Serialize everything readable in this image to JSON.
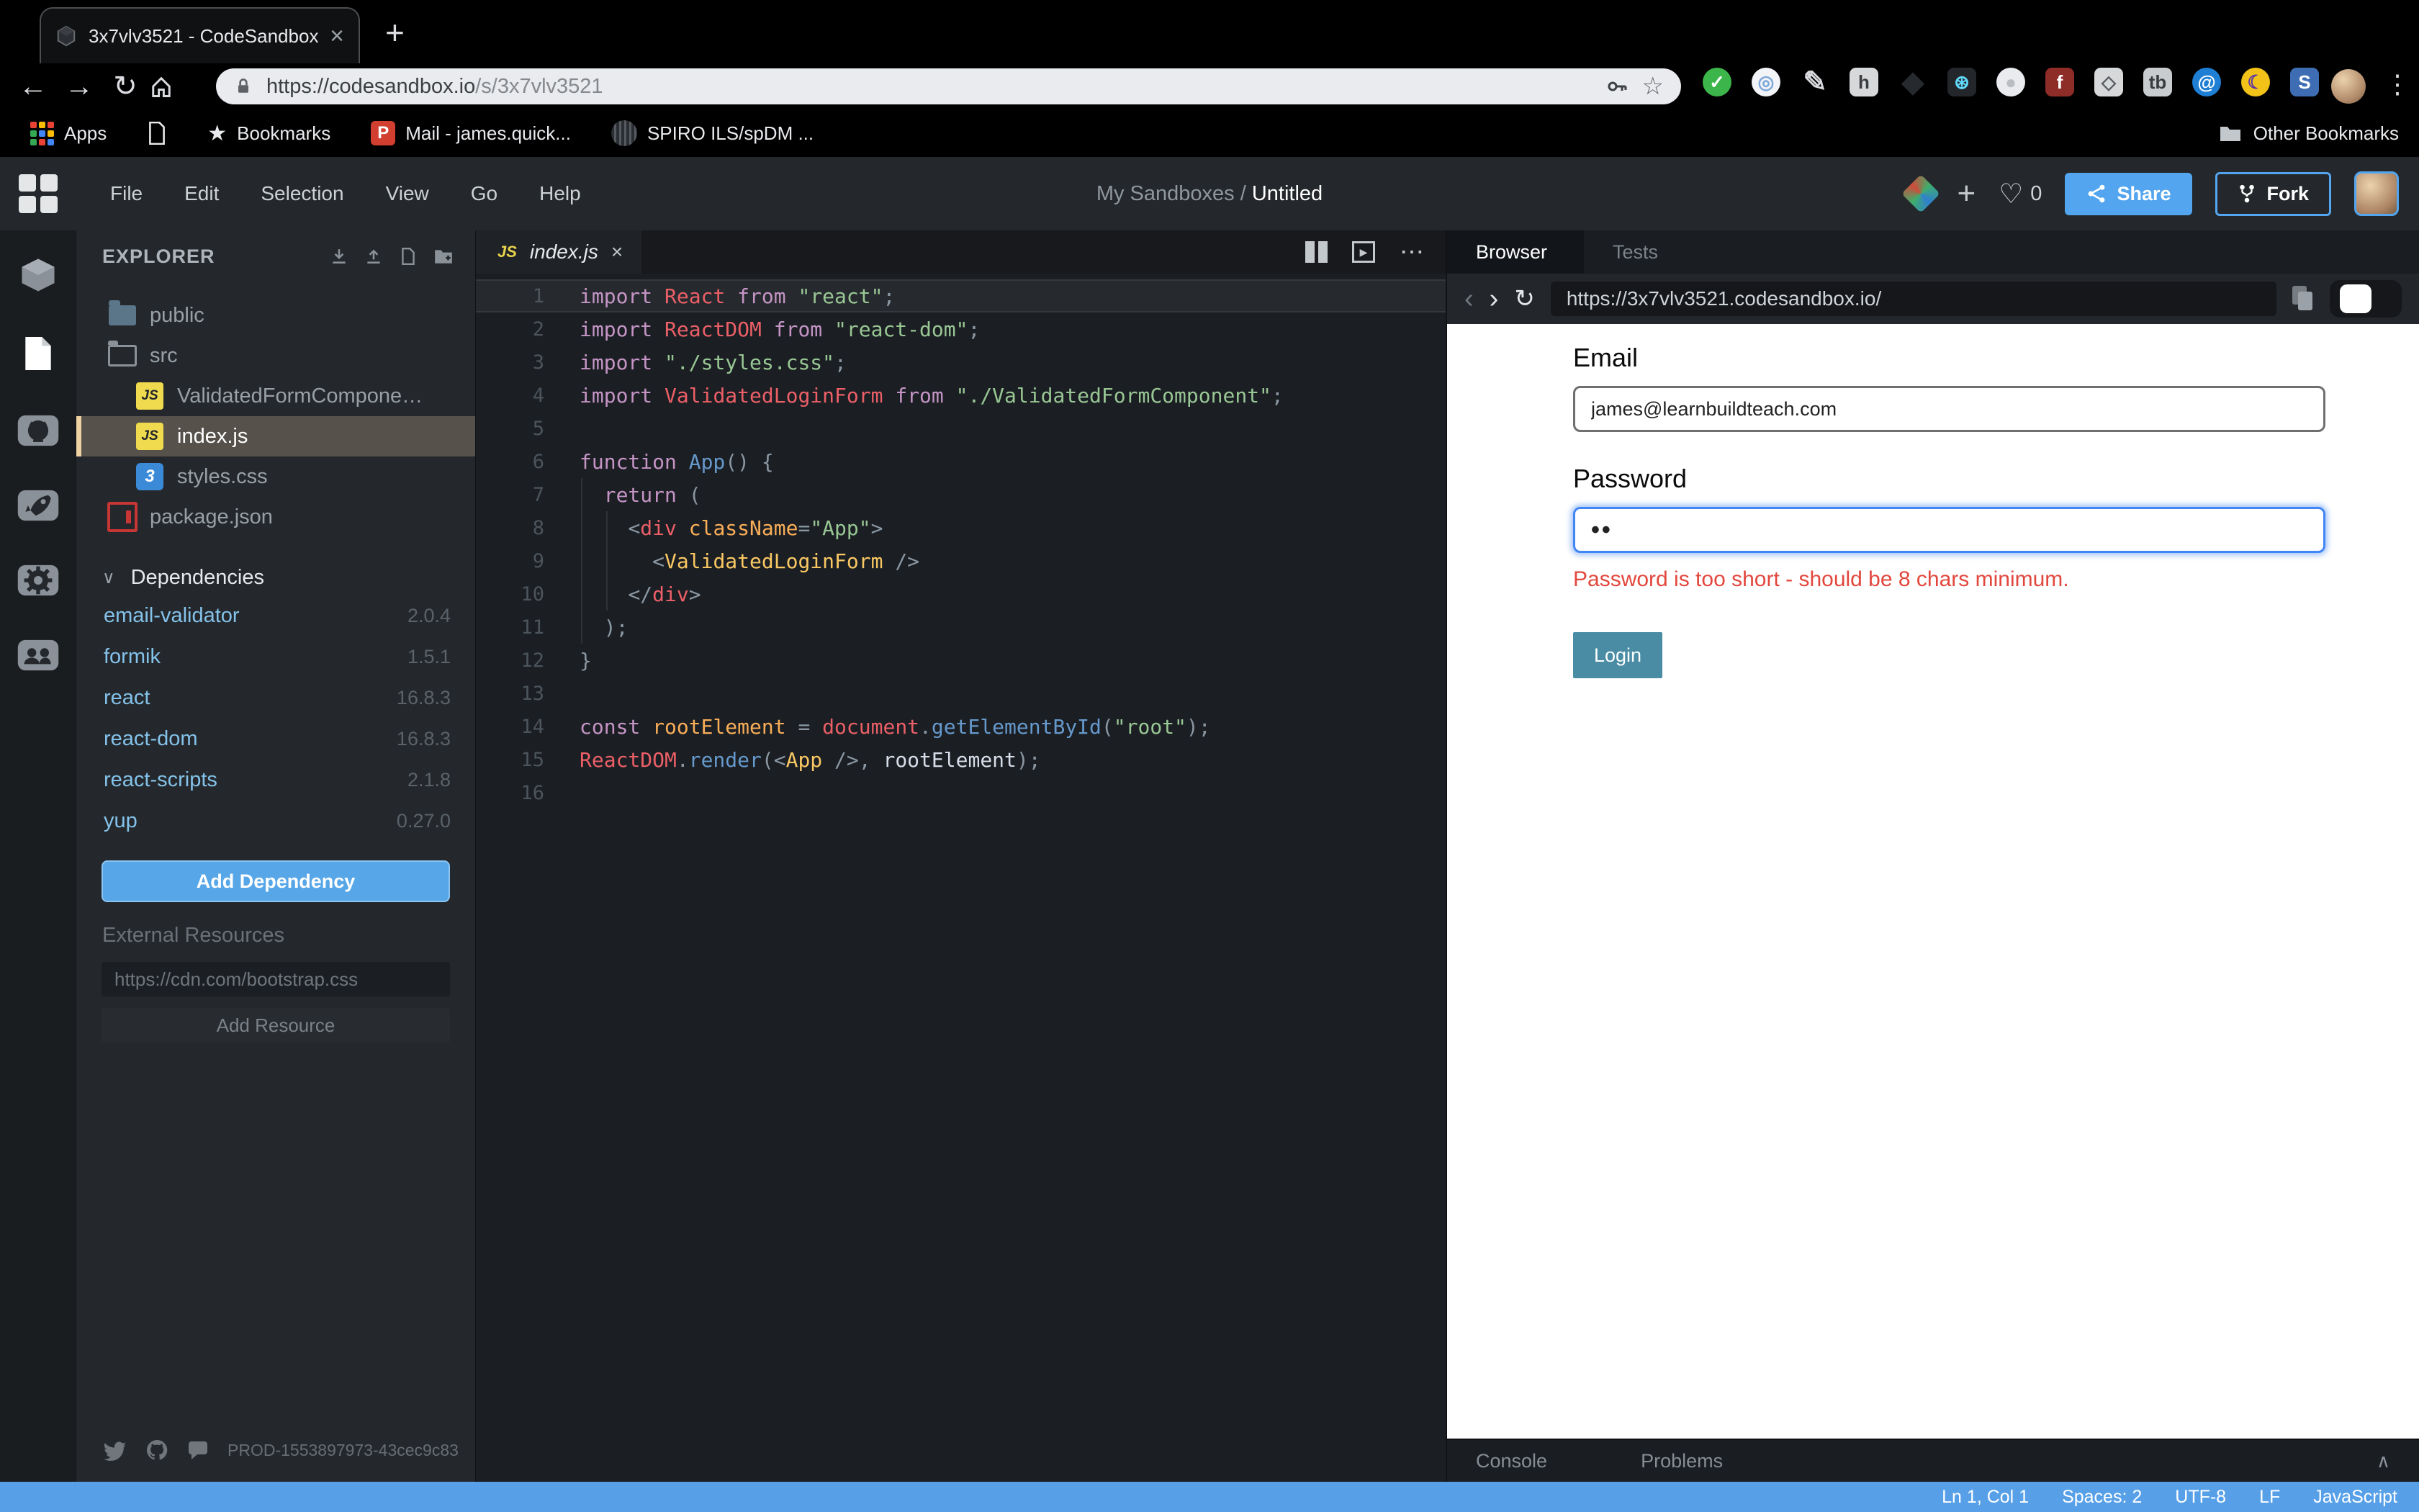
{
  "chrome": {
    "tab_title": "3x7vlv3521 - CodeSandbox",
    "url_base": "https://codesandbox.io",
    "url_path": "/s/3x7vlv3521",
    "bookmarks": [
      {
        "label": "Apps"
      },
      {
        "label": "Bookmarks"
      },
      {
        "label": "Mail - james.quick..."
      },
      {
        "label": "SPIRO ILS/spDM ..."
      }
    ],
    "other_bookmarks": "Other Bookmarks",
    "extensions": [
      {
        "name": "thumb-extension-icon",
        "bg": "#3cb54a",
        "fg": "#ffffff",
        "glyph": "✓",
        "shape": "circle"
      },
      {
        "name": "ring-extension-icon",
        "bg": "#f2f4f7",
        "fg": "#7da7d9",
        "glyph": "◎",
        "shape": "circle"
      },
      {
        "name": "pen-extension-icon",
        "bg": "transparent",
        "fg": "#d8dadd",
        "glyph": "✎",
        "shape": "plain"
      },
      {
        "name": "honey-extension-icon",
        "bg": "#d6d8da",
        "fg": "#3a3d40",
        "glyph": "h",
        "shape": "rounded"
      },
      {
        "name": "diamond-extension-icon",
        "bg": "transparent",
        "fg": "#26292d",
        "glyph": "◆",
        "shape": "plain"
      },
      {
        "name": "react-extension-icon",
        "bg": "#23272c",
        "fg": "#61dafb",
        "glyph": "⊛",
        "shape": "rounded"
      },
      {
        "name": "circle-extension-icon",
        "bg": "#e9ebee",
        "fg": "#b9bdc2",
        "glyph": "●",
        "shape": "circle"
      },
      {
        "name": "flash-extension-icon",
        "bg": "#8e2c28",
        "fg": "#ffffff",
        "glyph": "f",
        "shape": "rounded"
      },
      {
        "name": "tag-extension-icon",
        "bg": "#d6d8da",
        "fg": "#5a5e62",
        "glyph": "◇",
        "shape": "rounded"
      },
      {
        "name": "tb-extension-icon",
        "bg": "#c9cccf",
        "fg": "#3a3d40",
        "glyph": "tb",
        "shape": "rounded"
      },
      {
        "name": "at-extension-icon",
        "bg": "#1f7fd4",
        "fg": "#ffffff",
        "glyph": "@",
        "shape": "circle"
      },
      {
        "name": "moon-extension-icon",
        "bg": "#f2c218",
        "fg": "#5a35a8",
        "glyph": "☾",
        "shape": "circle"
      },
      {
        "name": "s-extension-icon",
        "bg": "#3e6db4",
        "fg": "#ffffff",
        "glyph": "S",
        "shape": "rounded"
      }
    ]
  },
  "header": {
    "menu": [
      "File",
      "Edit",
      "Selection",
      "View",
      "Go",
      "Help"
    ],
    "breadcrumb_parent": "My Sandboxes",
    "breadcrumb_sep": " / ",
    "breadcrumb_current": "Untitled",
    "like_count": "0",
    "share_label": "Share",
    "fork_label": "Fork"
  },
  "explorer": {
    "title": "EXPLORER",
    "files": [
      {
        "name": "public",
        "icon": "folder-filled",
        "depth": 1
      },
      {
        "name": "src",
        "icon": "folder-open",
        "depth": 1
      },
      {
        "name": "ValidatedFormCompone…",
        "icon": "js",
        "depth": 2
      },
      {
        "name": "index.js",
        "icon": "js",
        "depth": 2,
        "selected": true
      },
      {
        "name": "styles.css",
        "icon": "css",
        "depth": 2
      },
      {
        "name": "package.json",
        "icon": "npm",
        "depth": 1
      }
    ],
    "dependencies_title": "Dependencies",
    "dependencies": [
      {
        "name": "email-validator",
        "version": "2.0.4"
      },
      {
        "name": "formik",
        "version": "1.5.1"
      },
      {
        "name": "react",
        "version": "16.8.3"
      },
      {
        "name": "react-dom",
        "version": "16.8.3"
      },
      {
        "name": "react-scripts",
        "version": "2.1.8"
      },
      {
        "name": "yup",
        "version": "0.27.0"
      }
    ],
    "add_dependency_label": "Add Dependency",
    "external_resources_label": "External Resources",
    "resource_placeholder": "https://cdn.com/bootstrap.css",
    "add_resource_label": "Add Resource",
    "build_id": "PROD-1553897973-43cec9c83"
  },
  "editor": {
    "tab_label": "index.js",
    "tab_badge": "JS",
    "lines": [
      [
        [
          "kw",
          "import "
        ],
        [
          "var",
          "React "
        ],
        [
          "kw",
          "from "
        ],
        [
          "str",
          "\"react\""
        ],
        [
          "pun",
          ";"
        ]
      ],
      [
        [
          "kw",
          "import "
        ],
        [
          "var",
          "ReactDOM "
        ],
        [
          "kw",
          "from "
        ],
        [
          "str",
          "\"react-dom\""
        ],
        [
          "pun",
          ";"
        ]
      ],
      [
        [
          "kw",
          "import "
        ],
        [
          "str",
          "\"./styles.css\""
        ],
        [
          "pun",
          ";"
        ]
      ],
      [
        [
          "kw",
          "import "
        ],
        [
          "var",
          "ValidatedLoginForm "
        ],
        [
          "kw",
          "from "
        ],
        [
          "str",
          "\"./ValidatedFormComponent\""
        ],
        [
          "pun",
          ";"
        ]
      ],
      [],
      [
        [
          "kw",
          "function "
        ],
        [
          "fn",
          "App"
        ],
        [
          "pun",
          "() {"
        ]
      ],
      [
        [
          "pln",
          "  "
        ],
        [
          "kw",
          "return"
        ],
        [
          "pun",
          " ("
        ]
      ],
      [
        [
          "pln",
          "    "
        ],
        [
          "pun",
          "<"
        ],
        [
          "tag",
          "div "
        ],
        [
          "attr",
          "className"
        ],
        [
          "pun",
          "="
        ],
        [
          "str",
          "\"App\""
        ],
        [
          "pun",
          ">"
        ]
      ],
      [
        [
          "pln",
          "      "
        ],
        [
          "pun",
          "<"
        ],
        [
          "comp",
          "ValidatedLoginForm "
        ],
        [
          "pun",
          "/>"
        ]
      ],
      [
        [
          "pln",
          "    "
        ],
        [
          "pun",
          "</"
        ],
        [
          "tag",
          "div"
        ],
        [
          "pun",
          ">"
        ]
      ],
      [
        [
          "pln",
          "  "
        ],
        [
          "pun",
          ");"
        ]
      ],
      [
        [
          "pun",
          "}"
        ]
      ],
      [],
      [
        [
          "kw",
          "const "
        ],
        [
          "attr",
          "rootElement "
        ],
        [
          "pun",
          "= "
        ],
        [
          "var",
          "document"
        ],
        [
          "pun",
          "."
        ],
        [
          "fn",
          "getElementById"
        ],
        [
          "pun",
          "("
        ],
        [
          "str",
          "\"root\""
        ],
        [
          "pun",
          ");"
        ]
      ],
      [
        [
          "var",
          "ReactDOM"
        ],
        [
          "pun",
          "."
        ],
        [
          "fn",
          "render"
        ],
        [
          "pun",
          "(<"
        ],
        [
          "comp",
          "App "
        ],
        [
          "pun",
          "/>, "
        ],
        [
          "pln",
          "rootElement"
        ],
        [
          "pun",
          ");"
        ]
      ],
      []
    ]
  },
  "preview": {
    "tabs": [
      {
        "label": "Browser"
      },
      {
        "label": "Tests"
      }
    ],
    "url": "https://3x7vlv3521.codesandbox.io/",
    "form": {
      "email_label": "Email",
      "email_value": "james@learnbuildteach.com",
      "password_label": "Password",
      "password_value": "••",
      "error": "Password is too short - should be 8 chars minimum.",
      "login_label": "Login"
    },
    "console_tabs": [
      {
        "label": "Console"
      },
      {
        "label": "Problems"
      }
    ]
  },
  "statusbar": {
    "items": [
      "Ln 1, Col 1",
      "Spaces: 2",
      "UTF-8",
      "LF",
      "JavaScript"
    ]
  },
  "colors": {
    "status_bar": "#57a0e8",
    "share_button": "#52a5ee",
    "add_dependency_button": "#57a7e8",
    "login_button": "#4a8ca4",
    "error_text": "#e2473d",
    "dependency_link": "#84c2ea",
    "js_badge": "#f0db4f",
    "keyword": "#c594c5",
    "string": "#99c794",
    "identifier": "#ec5f67",
    "function": "#6699cc",
    "jsx_component": "#fac863"
  }
}
